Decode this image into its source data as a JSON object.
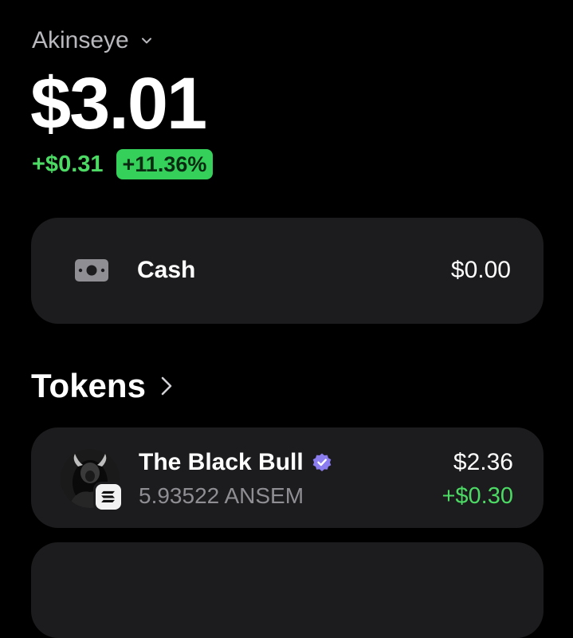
{
  "account": {
    "name": "Akinseye",
    "dropdown_icon": "chevron-down-icon"
  },
  "portfolio": {
    "balance": "$3.01",
    "change_value": "+$0.31",
    "change_percent": "+11.36%"
  },
  "cash": {
    "icon": "banknote-icon",
    "label": "Cash",
    "value": "$0.00"
  },
  "tokens_section": {
    "title": "Tokens",
    "arrow_icon": "chevron-right-icon",
    "items": [
      {
        "name": "The Black Bull",
        "verified_icon": "verified-badge-icon",
        "amount": "5.93522 ANSEM",
        "value": "$2.36",
        "change": "+$0.30",
        "avatar_icon": "bull-avatar",
        "chain_icon": "solana-icon"
      }
    ]
  },
  "colors": {
    "background": "#000000",
    "card": "#1c1c1e",
    "positive": "#4cd964",
    "positive_badge_bg": "#34d05a",
    "muted_text": "#8e8e93",
    "verified": "#8b7cf0"
  }
}
